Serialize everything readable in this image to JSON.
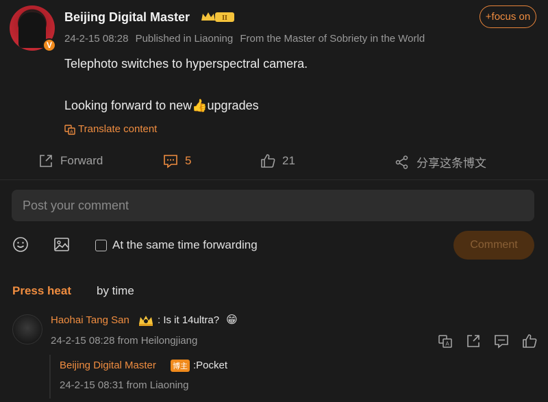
{
  "post": {
    "author": "Beijing Digital Master",
    "follow_label": "+focus on",
    "meta": {
      "time": "24-2-15 08:28",
      "location": "Published in Liaoning",
      "source": "From the Master of Sobriety in the World"
    },
    "text_line1": "Telephoto switches to hyperspectral camera.",
    "text_line2_pre": "Looking forward to new",
    "text_line2_emoji": "👍",
    "text_line2_post": "upgrades",
    "translate_label": "Translate content"
  },
  "actions": {
    "forward_label": "Forward",
    "comment_count": "5",
    "like_count": "21",
    "share_label": "分享这条博文"
  },
  "composer": {
    "placeholder": "Post your comment",
    "forward_checkbox_label": "At the same time forwarding",
    "submit_label": "Comment"
  },
  "sort_tabs": {
    "heat": "Press heat",
    "time": "by time"
  },
  "comments": [
    {
      "author": "Haohai Tang San",
      "text": ": Is it 14ultra?",
      "emoji": "😁",
      "meta": "24-2-15 08:28 from Heilongjiang",
      "reply": {
        "author": "Beijing Digital Master",
        "badge": "博主",
        "text": ":Pocket",
        "meta": "24-2-15 08:31 from Liaoning"
      }
    }
  ],
  "colors": {
    "accent": "#f08d40",
    "background": "#1b1b1b",
    "input_bg": "#2d2d2d",
    "vip_badge": "#f08a1c"
  },
  "icons": [
    "verified-v-icon",
    "crown-level-icon",
    "translate-icon",
    "forward-icon",
    "comment-icon",
    "like-icon",
    "share-icon",
    "emoji-icon",
    "image-icon",
    "checkbox-icon"
  ]
}
